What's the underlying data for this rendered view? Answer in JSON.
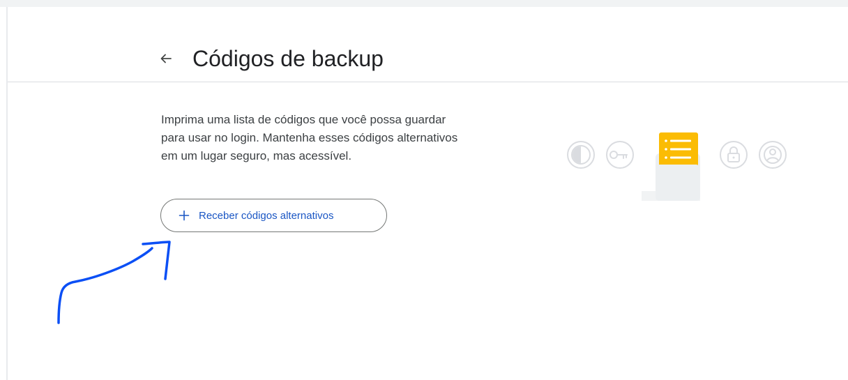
{
  "header": {
    "back_icon": "arrow-back-icon",
    "title": "Códigos de backup"
  },
  "content": {
    "description_lines": [
      "Imprima uma lista de códigos que você possa guardar",
      "para usar no login. Mantenha esses códigos alternativos",
      "em um lugar seguro, mas acessível."
    ],
    "button": {
      "icon": "plus-icon",
      "label": "Receber códigos alternativos"
    }
  },
  "illustration": {
    "icons": [
      "shield-icon",
      "key-icon",
      "document-list-icon",
      "lock-icon",
      "account-icon"
    ]
  },
  "colors": {
    "accent": "#1a56c4",
    "document": "#fbbc04",
    "annotation_ink": "#0b4ff5"
  }
}
